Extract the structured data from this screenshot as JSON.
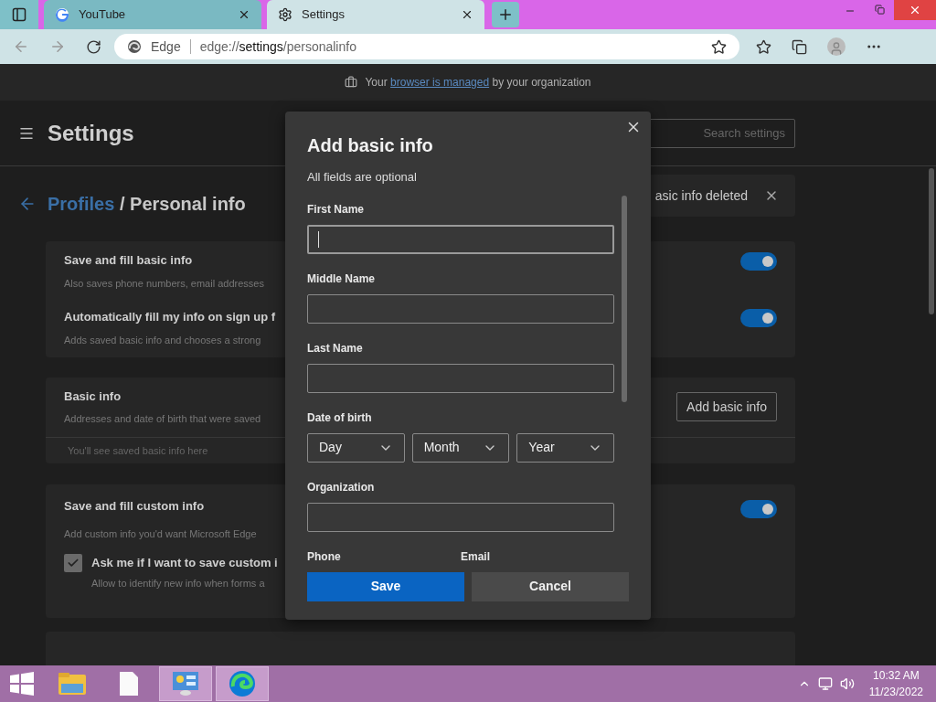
{
  "browser": {
    "tabs": [
      {
        "kind": "google",
        "title": "YouTube",
        "selected": false
      },
      {
        "kind": "gear",
        "title": "Settings",
        "selected": true
      }
    ],
    "address": {
      "site": "Edge",
      "url": "edge://**settings**/personalinfo"
    }
  },
  "managed_banner": {
    "before": "Your",
    "link": "browser is managed",
    "after": "by your organization"
  },
  "settings": {
    "title": "Settings",
    "search_placeholder": "Search settings",
    "breadcrumb": {
      "parent": "Profiles",
      "current": "/ Personal info"
    },
    "toast": "asic info deleted",
    "fill_card": {
      "rows": [
        {
          "title": "Save and fill basic info",
          "description": "Also saves phone numbers, email addresses",
          "on": true
        },
        {
          "title": "Automatically fill my info on sign up f",
          "description": "Adds saved basic info and chooses a strong",
          "on": true
        }
      ]
    },
    "basic_card": {
      "title": "Basic info",
      "description": "Addresses and date of birth that were saved",
      "button": "Add basic info",
      "empty": "You'll see saved basic info here"
    },
    "custom_card": {
      "title": "Save and fill custom info",
      "description": "Add custom info you'd want Microsoft Edge",
      "on": true,
      "checkbox": {
        "label": "Ask me if I want to save custom i",
        "description": "Allow to identify new info when forms a",
        "checked": true
      }
    }
  },
  "dialog": {
    "title": "Add basic info",
    "subtitle": "All fields are optional",
    "fields": [
      {
        "kind": "text",
        "label": "First Name",
        "focused": true
      },
      {
        "kind": "text",
        "label": "Middle Name",
        "focused": false
      },
      {
        "kind": "text",
        "label": "Last Name",
        "focused": false
      },
      {
        "kind": "date",
        "label": "Date of birth",
        "selects": [
          "Day",
          "Month",
          "Year"
        ]
      },
      {
        "kind": "text",
        "label": "Organization",
        "focused": false
      },
      {
        "kind": "labels",
        "labels": [
          "Phone",
          "Email"
        ]
      }
    ],
    "buttons": [
      {
        "label": "Save",
        "primary": true
      },
      {
        "label": "Cancel",
        "primary": false
      }
    ]
  },
  "taskbar": {
    "apps": [
      {
        "kind": "folder",
        "active": false
      },
      {
        "kind": "file",
        "active": false
      },
      {
        "kind": "control",
        "active": true
      },
      {
        "kind": "edge",
        "active": true
      }
    ],
    "time": "10:32 AM",
    "date": "11/23/2022"
  }
}
